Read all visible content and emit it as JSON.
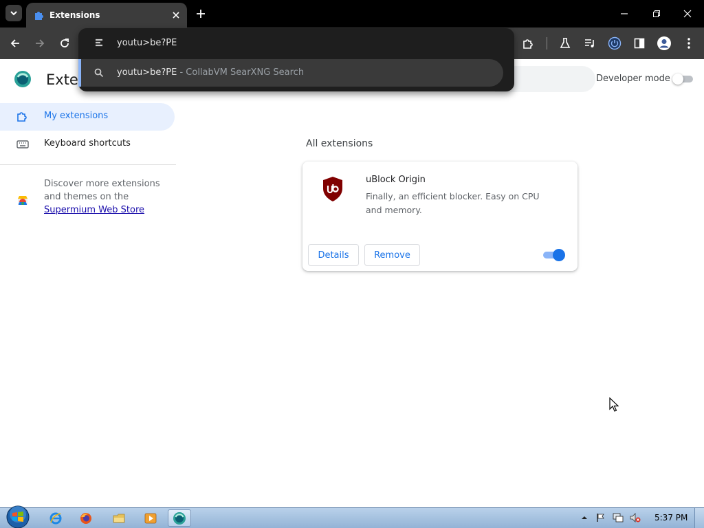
{
  "browser": {
    "tab": {
      "title": "Extensions"
    },
    "omnibox": {
      "input_value": "youtu>be?PE",
      "suggestion": {
        "text": "youtu>be?PE",
        "source": " - CollabVM SearXNG Search"
      }
    }
  },
  "page": {
    "title": "Exten",
    "developer_mode_label": "Developer mode",
    "developer_mode_enabled": false
  },
  "sidebar": {
    "items": [
      {
        "label": "My extensions",
        "active": true
      },
      {
        "label": "Keyboard shortcuts",
        "active": false
      }
    ],
    "store_text": "Discover more extensions and themes on the",
    "store_link": "Supermium Web Store"
  },
  "main": {
    "section_title": "All extensions",
    "extensions": [
      {
        "name": "uBlock Origin",
        "description": "Finally, an efficient blocker. Easy on CPU and memory.",
        "details_label": "Details",
        "remove_label": "Remove",
        "enabled": true
      }
    ]
  },
  "taskbar": {
    "time": "5:37 PM"
  },
  "colors": {
    "accent": "#1a73e8",
    "ublock_red": "#800000",
    "toolbar": "#3c3c3c",
    "tabstrip": "#000000"
  },
  "icons": [
    "tab-search-icon",
    "extensions-puzzle-icon",
    "close-icon",
    "plus-icon",
    "minimize-icon",
    "restore-icon",
    "back-arrow-icon",
    "forward-arrow-icon",
    "reload-icon",
    "site-info-icon",
    "search-icon",
    "labs-flask-icon",
    "media-controls-icon",
    "power-icon",
    "side-panel-icon",
    "profile-icon",
    "kebab-menu-icon",
    "keyboard-icon",
    "web-store-icon",
    "ublock-shield-icon",
    "windows-start-icon",
    "internet-explorer-icon",
    "firefox-icon",
    "file-explorer-icon",
    "media-player-icon",
    "supermium-icon"
  ]
}
